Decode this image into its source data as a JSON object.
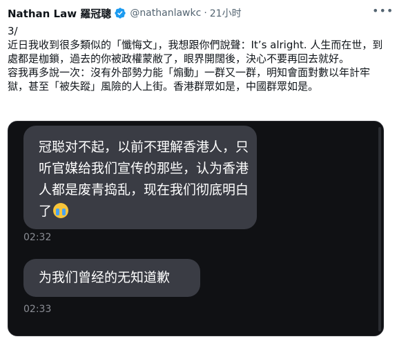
{
  "tweet": {
    "author": {
      "display_name": "Nathan Law 羅冠聰",
      "handle": "@nathanlawkc",
      "separator": "·",
      "time": "21小时",
      "verified_icon": "verified-badge-icon",
      "more_icon": "more-options-icon"
    },
    "text": {
      "line0": "3/",
      "paragraph1": "近日我收到很多類似的「懺悔文」，我想跟你們說聲：It’s alright. 人生而在世，到處都是枷鎖，過去的你被政權蒙敝了，眼界開闊後，決心不要再回去就好。",
      "paragraph2": "容我再多說一次：沒有外部勢力能「煽動」一群又一群，明知會面對數以年計牢獄，甚至「被失蹤」風險的人上街。香港群眾如是，中國群眾如是。"
    },
    "media": {
      "messages": [
        {
          "text": "冠聪对不起，以前不理解香港人，只听官媒给我们宣传的那些，认为香港人都是废青捣乱，现在我们彻底明白了",
          "emoji": "loudly-crying-face-icon",
          "time": "02:32"
        },
        {
          "text": "为我们曾经的无知道歉",
          "time": "02:33"
        }
      ]
    }
  }
}
